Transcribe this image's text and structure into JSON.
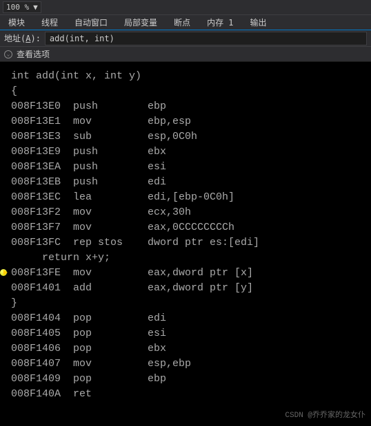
{
  "toolbar": {
    "zoom": "100 %"
  },
  "tabs": {
    "items": [
      {
        "label": "模块"
      },
      {
        "label": "线程"
      },
      {
        "label": "自动窗口"
      },
      {
        "label": "局部变量"
      },
      {
        "label": "断点"
      },
      {
        "label": "内存 1"
      },
      {
        "label": "输出"
      }
    ]
  },
  "address": {
    "label_prefix": "地址(",
    "label_key": "A",
    "label_suffix": "):",
    "value": "add(int, int)"
  },
  "options": {
    "label": "查看选项"
  },
  "disasm": {
    "lines": [
      {
        "type": "src",
        "text": "int add(int x, int y)"
      },
      {
        "type": "src",
        "text": "{"
      },
      {
        "type": "asm",
        "addr": "008F13E0",
        "op": "push",
        "args": "ebp"
      },
      {
        "type": "asm",
        "addr": "008F13E1",
        "op": "mov",
        "args": "ebp,esp"
      },
      {
        "type": "asm",
        "addr": "008F13E3",
        "op": "sub",
        "args": "esp,0C0h"
      },
      {
        "type": "asm",
        "addr": "008F13E9",
        "op": "push",
        "args": "ebx"
      },
      {
        "type": "asm",
        "addr": "008F13EA",
        "op": "push",
        "args": "esi"
      },
      {
        "type": "asm",
        "addr": "008F13EB",
        "op": "push",
        "args": "edi"
      },
      {
        "type": "asm",
        "addr": "008F13EC",
        "op": "lea",
        "args": "edi,[ebp-0C0h]"
      },
      {
        "type": "asm",
        "addr": "008F13F2",
        "op": "mov",
        "args": "ecx,30h"
      },
      {
        "type": "asm",
        "addr": "008F13F7",
        "op": "mov",
        "args": "eax,0CCCCCCCCh"
      },
      {
        "type": "asm",
        "addr": "008F13FC",
        "op": "rep stos",
        "args": "dword ptr es:[edi]"
      },
      {
        "type": "src",
        "text": "     return x+y;"
      },
      {
        "type": "asm",
        "addr": "008F13FE",
        "op": "mov",
        "args": "eax,dword ptr [x]",
        "bp": true
      },
      {
        "type": "asm",
        "addr": "008F1401",
        "op": "add",
        "args": "eax,dword ptr [y]"
      },
      {
        "type": "src",
        "text": "}"
      },
      {
        "type": "asm",
        "addr": "008F1404",
        "op": "pop",
        "args": "edi"
      },
      {
        "type": "asm",
        "addr": "008F1405",
        "op": "pop",
        "args": "esi"
      },
      {
        "type": "asm",
        "addr": "008F1406",
        "op": "pop",
        "args": "ebx"
      },
      {
        "type": "asm",
        "addr": "008F1407",
        "op": "mov",
        "args": "esp,ebp"
      },
      {
        "type": "asm",
        "addr": "008F1409",
        "op": "pop",
        "args": "ebp"
      },
      {
        "type": "asm",
        "addr": "008F140A",
        "op": "ret",
        "args": ""
      }
    ]
  },
  "watermark": "CSDN @乔乔家的龙女仆"
}
